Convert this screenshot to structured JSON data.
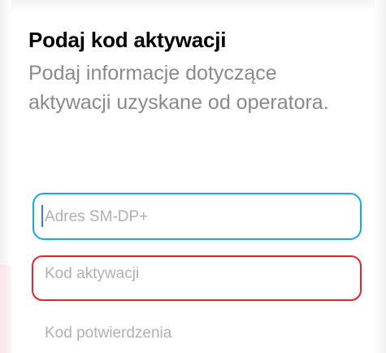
{
  "header": {
    "title": "Podaj kod aktywacji",
    "subtitle": "Podaj informacje dotyczące aktywacji uzyskane od operatora."
  },
  "form": {
    "smdp_address": {
      "placeholder": "Adres SM-DP+",
      "value": ""
    },
    "activation_code": {
      "placeholder": "Kod aktywacji",
      "value": ""
    },
    "confirmation_code": {
      "placeholder": "Kod potwierdzenia",
      "value": ""
    }
  },
  "annotations": {
    "blue_highlight_color": "#1aa7e8",
    "red_highlight_color": "#e3252d"
  },
  "colors": {
    "caret": "#3478f6",
    "placeholder": "#b0b0b4",
    "subtitle": "#8a8a8e"
  }
}
